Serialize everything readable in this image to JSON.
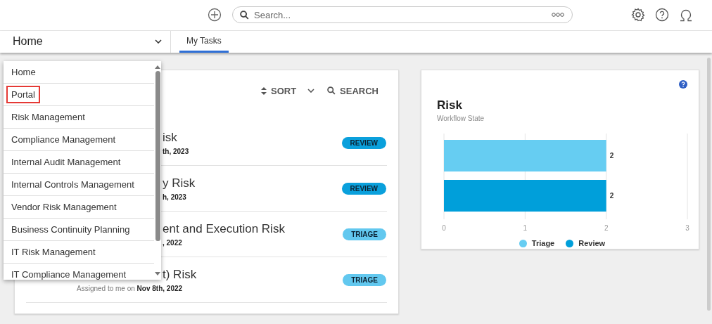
{
  "top_bar": {
    "search": {
      "placeholder": "Search..."
    }
  },
  "nav": {
    "workspace": "Home",
    "tabs": [
      {
        "label": "My Tasks",
        "selected": true
      }
    ]
  },
  "workspace_menu": {
    "items": [
      {
        "label": "Home",
        "highlighted": false
      },
      {
        "label": "Portal",
        "highlighted": true
      },
      {
        "label": "Risk Management",
        "highlighted": false
      },
      {
        "label": "Compliance Management",
        "highlighted": false
      },
      {
        "label": "Internal Audit Management",
        "highlighted": false
      },
      {
        "label": "Internal Controls Management",
        "highlighted": false
      },
      {
        "label": "Vendor Risk Management",
        "highlighted": false
      },
      {
        "label": "Business Continuity Planning",
        "highlighted": false
      },
      {
        "label": "IT Risk Management",
        "highlighted": false
      },
      {
        "label": "IT Compliance Management",
        "highlighted": false
      }
    ]
  },
  "tasks_card": {
    "sort": "SORT",
    "search": "SEARCH",
    "rows": [
      {
        "title": "isk",
        "assigned": "**th, 2023**",
        "state": "REVIEW",
        "kind": "review"
      },
      {
        "title": "y Risk",
        "assigned": "**h, 2023**",
        "state": "REVIEW",
        "kind": "review"
      },
      {
        "title": "ent and Execution Risk",
        "assigned": "**, 2022**",
        "state": "TRIAGE",
        "kind": "triage"
      },
      {
        "title": "t) Risk",
        "assigned": "Assigned to me on **Nov 8th, 2022**",
        "state": "TRIAGE",
        "kind": "triage"
      }
    ]
  },
  "risk_card": {
    "title": "Risk",
    "subtitle": "Workflow State",
    "chart_data": {
      "type": "bar",
      "orientation": "horizontal",
      "series": [
        {
          "name": "Triage",
          "color": "#66cdf2",
          "values": [
            2
          ]
        },
        {
          "name": "Review",
          "color": "#009fda",
          "values": [
            2
          ]
        }
      ],
      "xlim": [
        0,
        3
      ],
      "xticks": [
        0,
        1,
        2,
        3
      ],
      "data_labels": true
    }
  }
}
